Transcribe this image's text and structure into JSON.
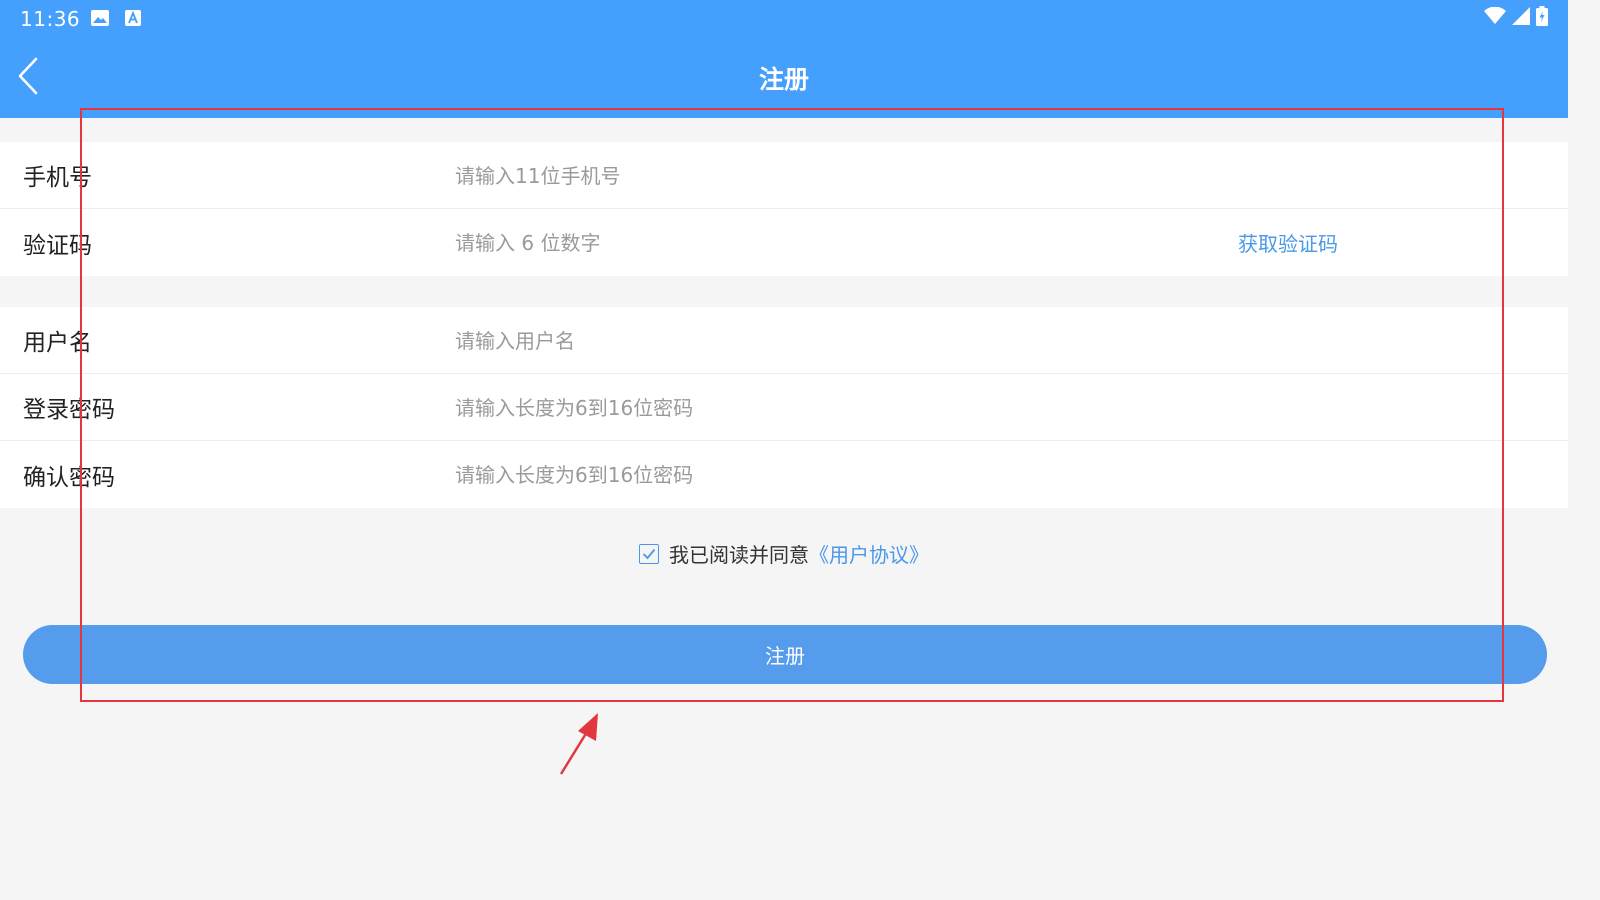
{
  "status_bar": {
    "time": "11:36",
    "icons_left": [
      "image-icon",
      "font-a-icon"
    ],
    "icons_right": [
      "wifi-icon",
      "signal-icon",
      "battery-icon"
    ]
  },
  "app_bar": {
    "title": "注册",
    "back_icon": "chevron-left-icon"
  },
  "form": {
    "phone": {
      "label": "手机号",
      "placeholder": "请输入11位手机号",
      "value": ""
    },
    "code": {
      "label": "验证码",
      "placeholder": "请输入 6 位数字",
      "value": "",
      "action": "获取验证码"
    },
    "username": {
      "label": "用户名",
      "placeholder": "请输入用户名",
      "value": ""
    },
    "password": {
      "label": "登录密码",
      "placeholder": "请输入长度为6到16位密码",
      "value": ""
    },
    "confirm": {
      "label": "确认密码",
      "placeholder": "请输入长度为6到16位密码",
      "value": ""
    }
  },
  "agreement": {
    "checked": true,
    "text": "我已阅读并同意",
    "link": "《用户协议》"
  },
  "register_button": {
    "label": "注册"
  },
  "colors": {
    "primary": "#459ffc",
    "button": "#559ced",
    "link": "#4a98e8",
    "annotation": "#e2373f",
    "background": "#f5f5f5"
  }
}
